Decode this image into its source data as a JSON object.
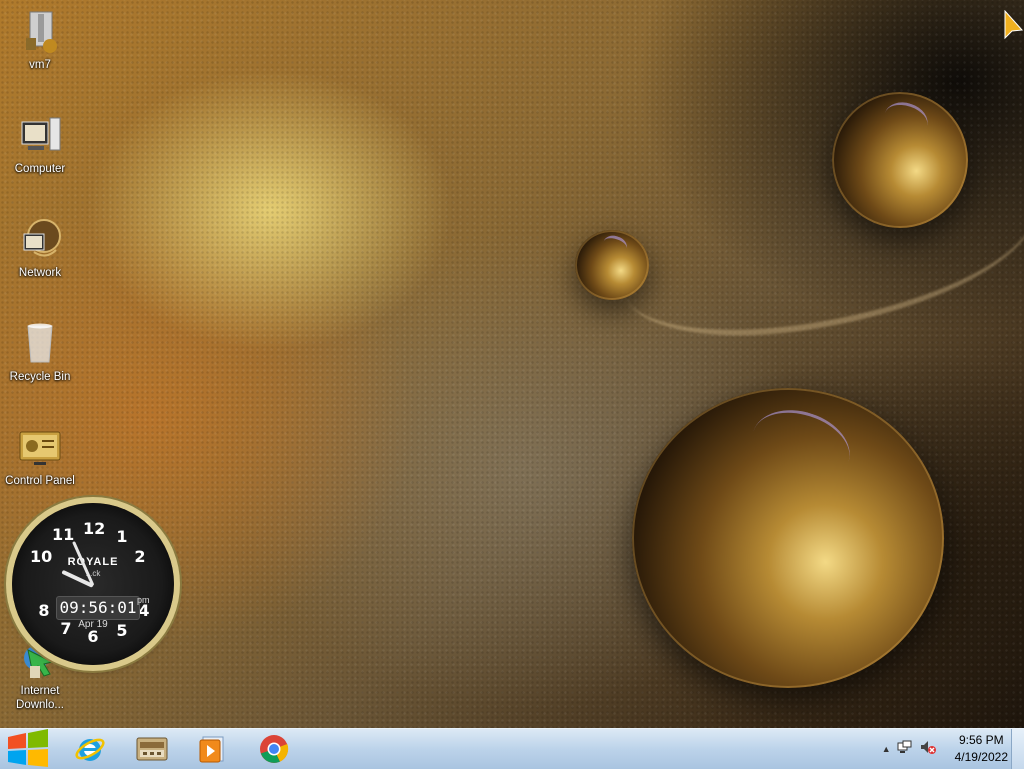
{
  "desktop": {
    "icons": [
      {
        "label": "vm7",
        "icon": "folder-zip-icon"
      },
      {
        "label": "Computer",
        "icon": "computer-icon"
      },
      {
        "label": "Network",
        "icon": "network-icon"
      },
      {
        "label": "Recycle Bin",
        "icon": "recycle-bin-icon"
      },
      {
        "label": "Control Panel",
        "icon": "control-panel-icon"
      },
      {
        "label": "Internet Downlo...",
        "label_line1": "Internet",
        "label_line2": "Downlo...",
        "icon": "idm-icon"
      }
    ]
  },
  "clock_gadget": {
    "numbers": [
      "12",
      "1",
      "2",
      "4",
      "5",
      "6",
      "7",
      "8",
      "10",
      "11"
    ],
    "brand": "ROYALE",
    "brand_sub": "...ck",
    "digital_time": "09:56:01",
    "ampm": "pm",
    "date": "Apr 19"
  },
  "taskbar": {
    "start_icon": "windows-start-icon",
    "pinned": [
      {
        "name": "internet-explorer-icon"
      },
      {
        "name": "file-manager-icon"
      },
      {
        "name": "media-player-icon"
      },
      {
        "name": "chrome-icon"
      }
    ],
    "tray": {
      "time": "9:56 PM",
      "date": "4/19/2022"
    }
  }
}
